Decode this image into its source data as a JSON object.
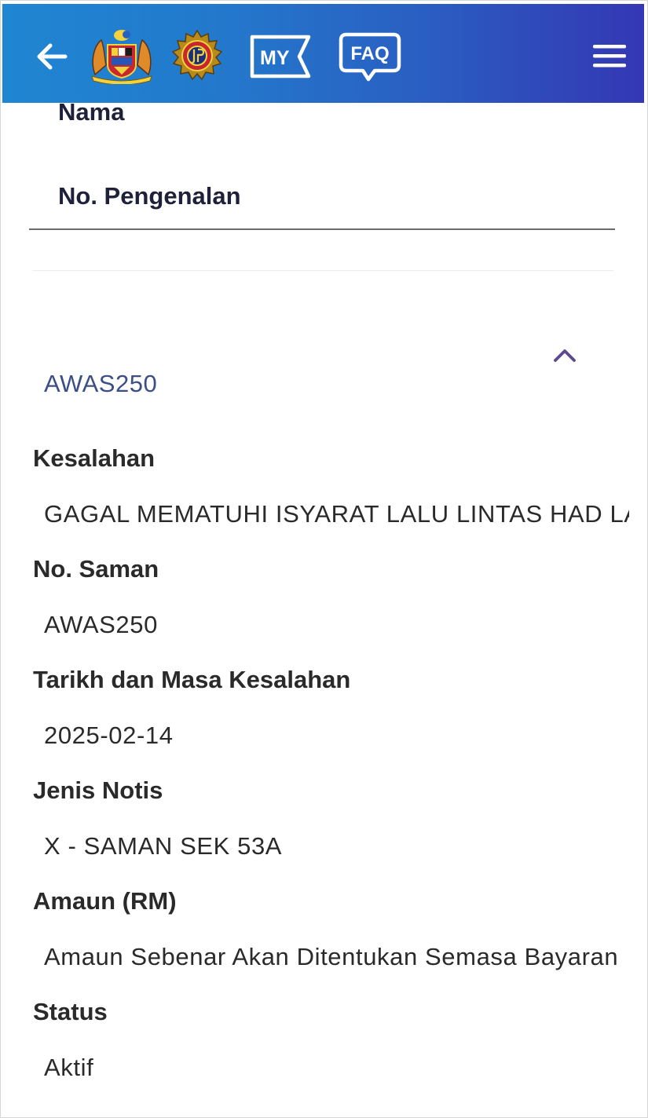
{
  "header": {
    "icons": {
      "back": "arrow-left-icon",
      "crest": "malaysia-coat-of-arms-icon",
      "agency": "jpj-emblem-icon",
      "my": "my-app-icon",
      "faq": "faq-icon",
      "menu": "hamburger-menu-icon"
    },
    "my_label": "MY",
    "faq_label": "FAQ",
    "colors": {
      "gradient_start": "#1f86d2",
      "gradient_end": "#3437b4"
    }
  },
  "profile": {
    "name_label": "Nama",
    "id_label": "No. Pengenalan"
  },
  "notice": {
    "reference": "AWAS250",
    "expand_icon": "chevron-up-icon",
    "fields": [
      {
        "label": "Kesalahan",
        "value": "GAGAL MEMATUHI ISYARAT LALU LINTAS HAD LAJU"
      },
      {
        "label": "No. Saman",
        "value": "AWAS250"
      },
      {
        "label": "Tarikh dan Masa Kesalahan",
        "value": "2025-02-14"
      },
      {
        "label": "Jenis Notis",
        "value": "X - SAMAN SEK 53A"
      },
      {
        "label": "Amaun (RM)",
        "value": "Amaun Sebenar Akan Ditentukan Semasa Bayaran"
      },
      {
        "label": "Status",
        "value": "Aktif"
      }
    ]
  }
}
